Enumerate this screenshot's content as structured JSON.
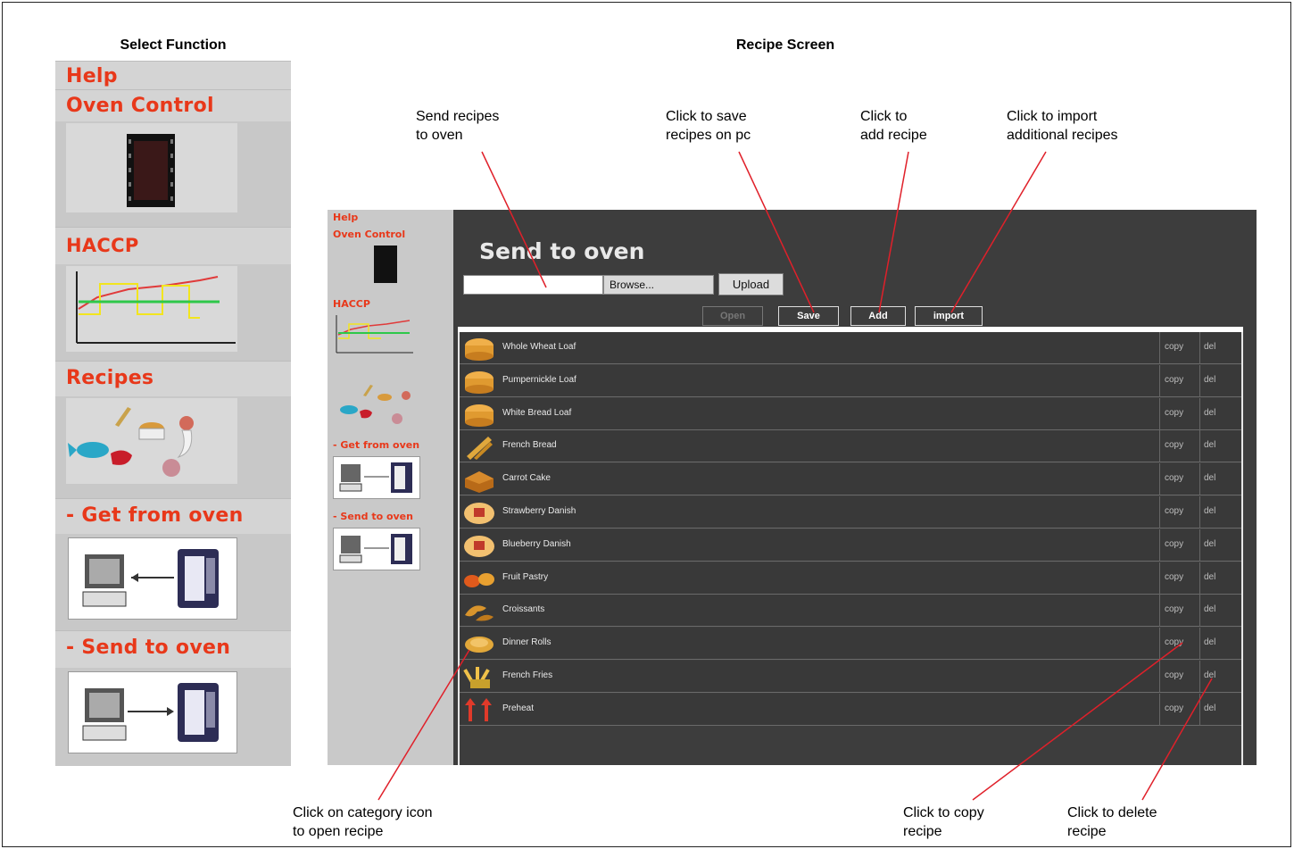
{
  "titles": {
    "left": "Select Function",
    "right": "Recipe Screen"
  },
  "left_panel": {
    "help": "Help",
    "oven_control": "Oven Control",
    "haccp": "HACCP",
    "recipes": "Recipes",
    "get_from_oven": "- Get from oven",
    "send_to_oven": "- Send to oven"
  },
  "mini_side": {
    "help": "Help",
    "oven_control": "Oven Control",
    "haccp": "HACCP",
    "get_from_oven": "- Get from oven",
    "send_to_oven": "- Send to oven"
  },
  "recipe_screen": {
    "title": "Send to oven",
    "file_value": "",
    "browse": "Browse...",
    "upload": "Upload",
    "toolbar": {
      "open": "Open",
      "save": "Save",
      "add": "Add",
      "import": "import"
    },
    "copy_label": "copy",
    "del_label": "del",
    "recipes": [
      {
        "name": "Whole Wheat Loaf",
        "icon": "bread-loaf-icon"
      },
      {
        "name": "Pumpernickle Loaf",
        "icon": "bread-loaf-icon"
      },
      {
        "name": "White Bread Loaf",
        "icon": "bread-loaf-icon"
      },
      {
        "name": "French Bread",
        "icon": "baguette-icon"
      },
      {
        "name": "Carrot Cake",
        "icon": "cake-icon"
      },
      {
        "name": "Strawberry Danish",
        "icon": "danish-icon"
      },
      {
        "name": "Blueberry Danish",
        "icon": "danish-icon"
      },
      {
        "name": "Fruit Pastry",
        "icon": "pastry-icon"
      },
      {
        "name": "Croissants",
        "icon": "croissant-icon"
      },
      {
        "name": "Dinner Rolls",
        "icon": "roll-icon"
      },
      {
        "name": "French Fries",
        "icon": "fries-icon"
      },
      {
        "name": "Preheat",
        "icon": "preheat-icon"
      }
    ]
  },
  "callouts": {
    "send": "Send recipes\nto oven",
    "save": "Click to save\nrecipes on pc",
    "add": "Click to\nadd recipe",
    "import": "Click to import\nadditional recipes",
    "open": "Click on category icon\nto open recipe",
    "copy": "Click to copy\nrecipe",
    "delete": "Click to delete\nrecipe"
  },
  "colors": {
    "accent_red": "#e8381a",
    "annotation_line": "#e0202a",
    "screen_bg": "#3d3d3d"
  }
}
